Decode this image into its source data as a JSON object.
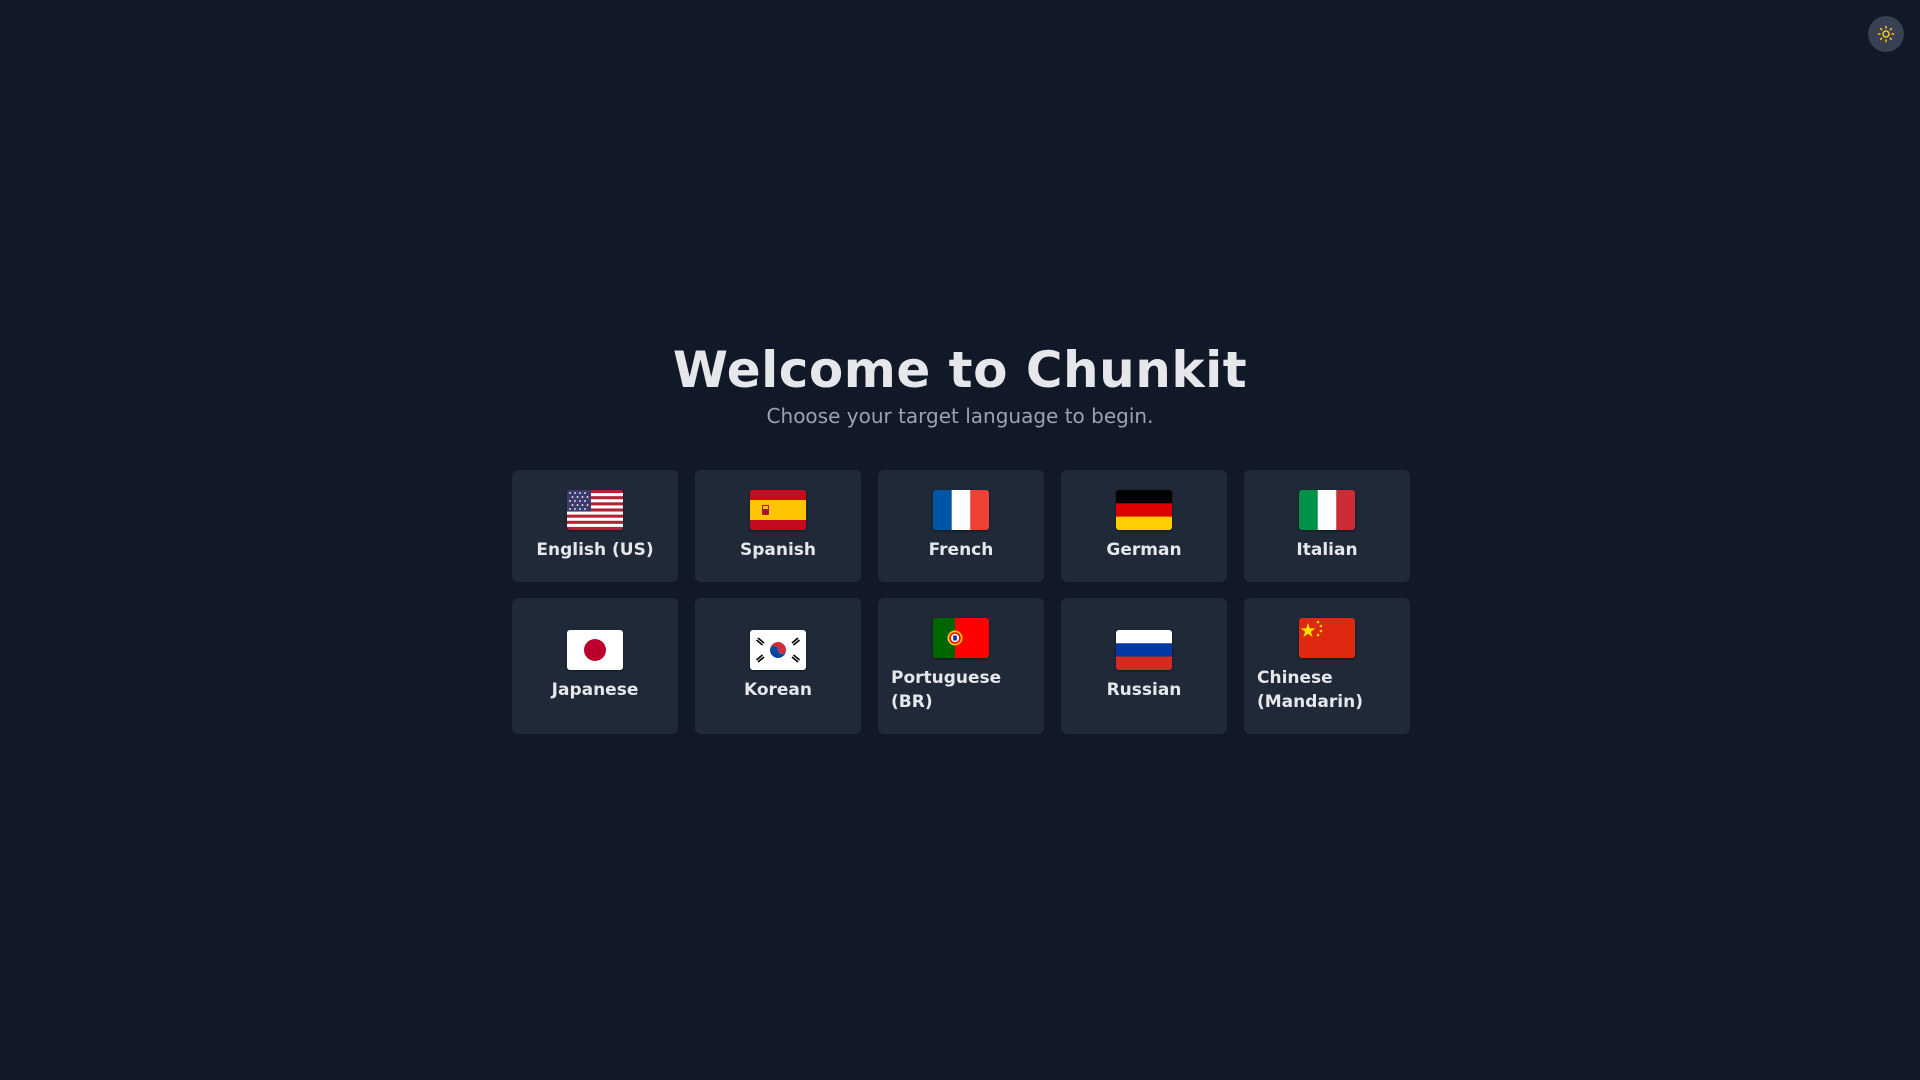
{
  "header": {
    "theme_toggle_icon": "sun-icon"
  },
  "main": {
    "title": "Welcome to Chunkit",
    "subtitle": "Choose your target language to begin."
  },
  "languages": [
    {
      "label": "English (US)",
      "flag_icon": "us-flag-icon"
    },
    {
      "label": "Spanish",
      "flag_icon": "spain-flag-icon"
    },
    {
      "label": "French",
      "flag_icon": "france-flag-icon"
    },
    {
      "label": "German",
      "flag_icon": "germany-flag-icon"
    },
    {
      "label": "Italian",
      "flag_icon": "italy-flag-icon"
    },
    {
      "label": "Japanese",
      "flag_icon": "japan-flag-icon"
    },
    {
      "label": "Korean",
      "flag_icon": "south-korea-flag-icon"
    },
    {
      "label": "Portuguese (BR)",
      "flag_icon": "portugal-flag-icon"
    },
    {
      "label": "Russian",
      "flag_icon": "russia-flag-icon"
    },
    {
      "label": "Chinese (Mandarin)",
      "flag_icon": "china-flag-icon"
    }
  ],
  "colors": {
    "background": "#111827",
    "card": "#1f2937",
    "text": "#e5e7eb",
    "muted_text": "#9ca3af",
    "toggle_bg": "#374151",
    "sun": "#facc15"
  }
}
